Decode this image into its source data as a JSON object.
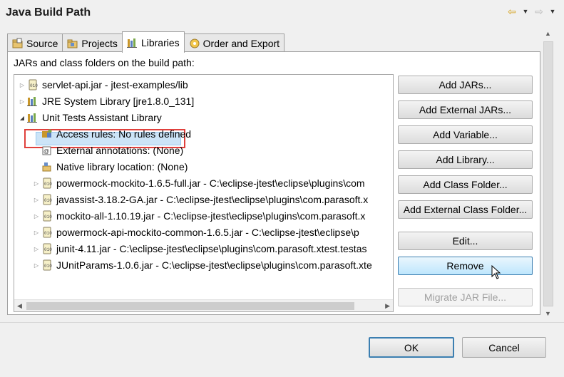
{
  "dialog": {
    "title": "Java Build Path"
  },
  "nav": {
    "back_icon": "back-arrow-icon",
    "forward_icon": "forward-arrow-icon"
  },
  "tabs": [
    {
      "label": "Source",
      "active": false
    },
    {
      "label": "Projects",
      "active": false
    },
    {
      "label": "Libraries",
      "active": true
    },
    {
      "label": "Order and Export",
      "active": false
    }
  ],
  "panel": {
    "label": "JARs and class folders on the build path:"
  },
  "tree": {
    "items": [
      {
        "label": "servlet-api.jar - jtest-examples/lib",
        "icon": "jar-icon",
        "expand": "collapsed",
        "level": 0
      },
      {
        "label": "JRE System Library [jre1.8.0_131]",
        "icon": "library-icon",
        "expand": "collapsed",
        "level": 0
      },
      {
        "label": "Unit Tests Assistant Library",
        "icon": "library-icon",
        "expand": "expanded",
        "level": 0,
        "selected": true
      },
      {
        "label": "Access rules: No rules defined",
        "icon": "access-rules-icon",
        "expand": "none",
        "level": 1
      },
      {
        "label": "External annotations: (None)",
        "icon": "annotations-icon",
        "expand": "none",
        "level": 1
      },
      {
        "label": "Native library location: (None)",
        "icon": "native-library-icon",
        "expand": "none",
        "level": 1
      },
      {
        "label": "powermock-mockito-1.6.5-full.jar - C:\\eclipse-jtest\\eclipse\\plugins\\com",
        "icon": "jar-icon",
        "expand": "collapsed",
        "level": 1
      },
      {
        "label": "javassist-3.18.2-GA.jar - C:\\eclipse-jtest\\eclipse\\plugins\\com.parasoft.x",
        "icon": "jar-icon",
        "expand": "collapsed",
        "level": 1
      },
      {
        "label": "mockito-all-1.10.19.jar - C:\\eclipse-jtest\\eclipse\\plugins\\com.parasoft.x",
        "icon": "jar-icon",
        "expand": "collapsed",
        "level": 1
      },
      {
        "label": "powermock-api-mockito-common-1.6.5.jar - C:\\eclipse-jtest\\eclipse\\p",
        "icon": "jar-icon",
        "expand": "collapsed",
        "level": 1
      },
      {
        "label": "junit-4.11.jar - C:\\eclipse-jtest\\eclipse\\plugins\\com.parasoft.xtest.testas",
        "icon": "jar-icon",
        "expand": "collapsed",
        "level": 1
      },
      {
        "label": "JUnitParams-1.0.6.jar - C:\\eclipse-jtest\\eclipse\\plugins\\com.parasoft.xte",
        "icon": "jar-icon",
        "expand": "collapsed",
        "level": 1
      }
    ]
  },
  "buttons": {
    "add_jars": "Add JARs...",
    "add_external_jars": "Add External JARs...",
    "add_variable": "Add Variable...",
    "add_library": "Add Library...",
    "add_class_folder": "Add Class Folder...",
    "add_external_class_folder": "Add External Class Folder...",
    "edit": "Edit...",
    "remove": "Remove",
    "migrate_jar": "Migrate JAR File..."
  },
  "footer": {
    "ok": "OK",
    "cancel": "Cancel"
  },
  "colors": {
    "highlight_border": "#e0403c",
    "selection": "#cce4f7",
    "button_hover": "#bee6fd",
    "default_button_border": "#3c7fb1"
  }
}
